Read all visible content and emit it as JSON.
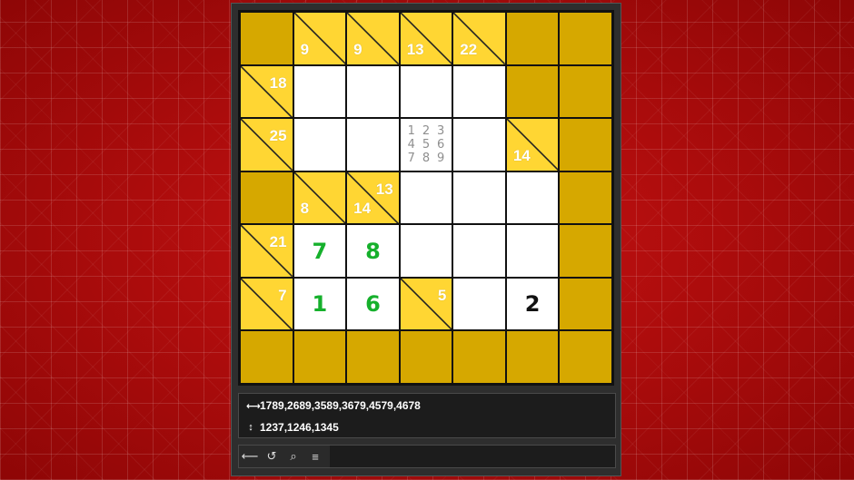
{
  "board": {
    "rows": [
      [
        {
          "type": "block"
        },
        {
          "type": "clue",
          "down": "9",
          "across": ""
        },
        {
          "type": "clue",
          "down": "9",
          "across": ""
        },
        {
          "type": "clue",
          "down": "13",
          "across": ""
        },
        {
          "type": "clue",
          "down": "22",
          "across": ""
        },
        {
          "type": "block"
        },
        {
          "type": "block"
        }
      ],
      [
        {
          "type": "clue",
          "down": "",
          "across": "18"
        },
        {
          "type": "white"
        },
        {
          "type": "white"
        },
        {
          "type": "white"
        },
        {
          "type": "white"
        },
        {
          "type": "block"
        },
        {
          "type": "block"
        }
      ],
      [
        {
          "type": "clue",
          "down": "",
          "across": "25"
        },
        {
          "type": "white"
        },
        {
          "type": "white"
        },
        {
          "type": "white",
          "pencil": [
            "1",
            "2",
            "3",
            "4",
            "5",
            "6",
            "7",
            "8",
            "9"
          ]
        },
        {
          "type": "white"
        },
        {
          "type": "clue",
          "down": "14",
          "across": ""
        },
        {
          "type": "block"
        }
      ],
      [
        {
          "type": "block"
        },
        {
          "type": "clue",
          "down": "8",
          "across": ""
        },
        {
          "type": "clue",
          "down": "14",
          "across": "13"
        },
        {
          "type": "white"
        },
        {
          "type": "white"
        },
        {
          "type": "white"
        },
        {
          "type": "block"
        }
      ],
      [
        {
          "type": "clue",
          "down": "",
          "across": "21"
        },
        {
          "type": "white",
          "value": "7",
          "color": "green"
        },
        {
          "type": "white",
          "value": "8",
          "color": "green"
        },
        {
          "type": "white"
        },
        {
          "type": "white"
        },
        {
          "type": "white"
        },
        {
          "type": "block"
        }
      ],
      [
        {
          "type": "clue",
          "down": "",
          "across": "7"
        },
        {
          "type": "white",
          "value": "1",
          "color": "green"
        },
        {
          "type": "white",
          "value": "6",
          "color": "green"
        },
        {
          "type": "clue",
          "down": "",
          "across": "5"
        },
        {
          "type": "white"
        },
        {
          "type": "white",
          "value": "2",
          "color": "black"
        },
        {
          "type": "block"
        }
      ],
      [
        {
          "type": "block"
        },
        {
          "type": "block"
        },
        {
          "type": "block"
        },
        {
          "type": "block"
        },
        {
          "type": "block"
        },
        {
          "type": "block"
        },
        {
          "type": "block"
        }
      ]
    ]
  },
  "combos": {
    "across_icon": "horizontal-arrow-icon",
    "across": "1789,2689,3589,3679,4579,4678",
    "down_icon": "vertical-arrow-icon",
    "down": "1237,1246,1345"
  },
  "toolbar": {
    "buttons": [
      {
        "name": "erase-icon",
        "glyph": "⟵"
      },
      {
        "name": "undo-icon",
        "glyph": "↺"
      },
      {
        "name": "search-icon",
        "glyph": "⌕"
      },
      {
        "name": "menu-icon",
        "glyph": "≡"
      }
    ]
  },
  "colors": {
    "block": "#d6a800",
    "clue": "#ffd633",
    "white": "#ffffff",
    "entry_green": "#16b02c",
    "entry_black": "#111111",
    "background": "#b00a0a"
  }
}
